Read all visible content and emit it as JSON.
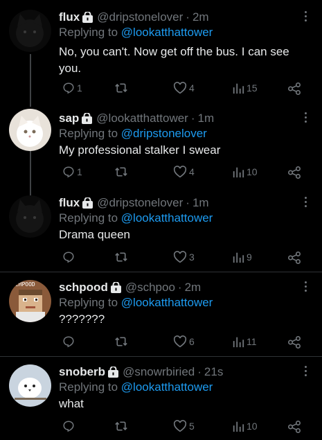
{
  "tweets": [
    {
      "name": "flux",
      "handle": "@dripstonelover",
      "time": "2m",
      "reply_prefix": "Replying to",
      "reply_to": "@lookatthattower",
      "text": "No, you can't. Now get off the bus. I can see you.",
      "replies": "1",
      "retweets": "",
      "likes": "4",
      "views": "15",
      "avatar": "black-cat"
    },
    {
      "name": "sap",
      "handle": "@lookatthattower",
      "time": "1m",
      "reply_prefix": "Replying to",
      "reply_to": "@dripstonelover",
      "text": "My professional stalker I swear",
      "replies": "1",
      "retweets": "",
      "likes": "4",
      "views": "10",
      "avatar": "white-cat"
    },
    {
      "name": "flux",
      "handle": "@dripstonelover",
      "time": "1m",
      "reply_prefix": "Replying to",
      "reply_to": "@lookatthattower",
      "text": "Drama queen",
      "replies": "",
      "retweets": "",
      "likes": "3",
      "views": "9",
      "avatar": "black-cat"
    },
    {
      "name": "schpood",
      "handle": "@schpoo",
      "time": "2m",
      "reply_prefix": "Replying to",
      "reply_to": "@lookatthattower",
      "text": "???????",
      "replies": "",
      "retweets": "",
      "likes": "6",
      "views": "11",
      "avatar": "pixel-character",
      "avatar_label": "SCHPOOD"
    },
    {
      "name": "snoberb",
      "handle": "@snowrbiried",
      "time": "21s",
      "reply_prefix": "Replying to",
      "reply_to": "@lookatthattower",
      "text": "what",
      "replies": "",
      "retweets": "",
      "likes": "5",
      "views": "10",
      "avatar": "white-bird"
    }
  ],
  "separator": "·",
  "colors": {
    "background": "#000000",
    "text": "#e7e9ea",
    "muted": "#71767b",
    "link": "#1d9bf0",
    "divider": "#2f3336"
  }
}
